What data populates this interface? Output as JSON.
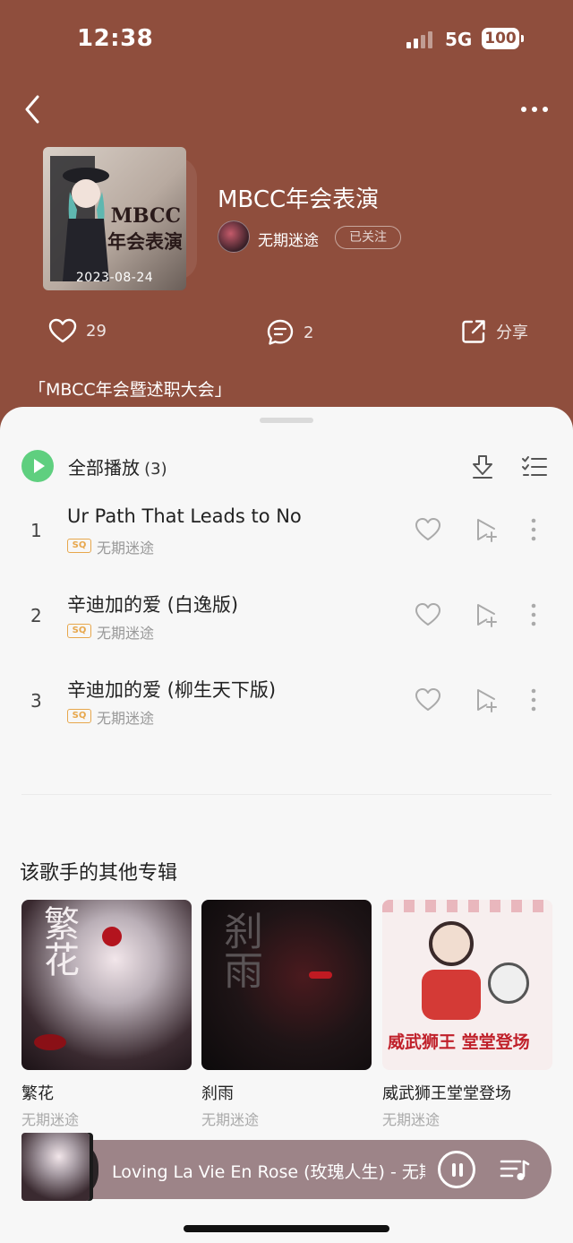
{
  "status_bar": {
    "time": "12:38",
    "network": "5G",
    "battery": "100"
  },
  "album": {
    "title": "MBCC年会表演",
    "cover_line1": "MBCC",
    "cover_line2": "年会表演",
    "cover_date": "2023-08-24",
    "artist": "无期迷途",
    "follow_label": "已关注",
    "likes": "29",
    "comments": "2",
    "share_label": "分享",
    "description": "「MBCC年会暨述职大会」"
  },
  "tracklist": {
    "play_all_label": "全部播放",
    "count": "(3)",
    "quality_badge": "SQ",
    "songs": [
      {
        "index": "1",
        "title": "Ur Path That Leads to No",
        "artist": "无期迷途"
      },
      {
        "index": "2",
        "title": "辛迪加的爱 (白逸版)",
        "artist": "无期迷途"
      },
      {
        "index": "3",
        "title": "辛迪加的爱 (柳生天下版)",
        "artist": "无期迷途"
      }
    ]
  },
  "other_albums": {
    "section_title": "该歌手的其他专辑",
    "items": [
      {
        "name": "繁花",
        "artist": "无期迷途",
        "art_text": "繁花"
      },
      {
        "name": "刹雨",
        "artist": "无期迷途",
        "art_text": "刹雨"
      },
      {
        "name": "威武狮王堂堂登场",
        "artist": "无期迷途",
        "art_text": "威武狮王 堂堂登场"
      }
    ]
  },
  "mini_player": {
    "now_playing": "Loving La Vie En Rose (玫瑰人生) - 无期迷途"
  },
  "colors": {
    "hero_bg": "#8f4e3d",
    "play_green": "#5fcf7f",
    "sq_orange": "#e7a74c",
    "mini_player_bg": "#9d8488"
  }
}
